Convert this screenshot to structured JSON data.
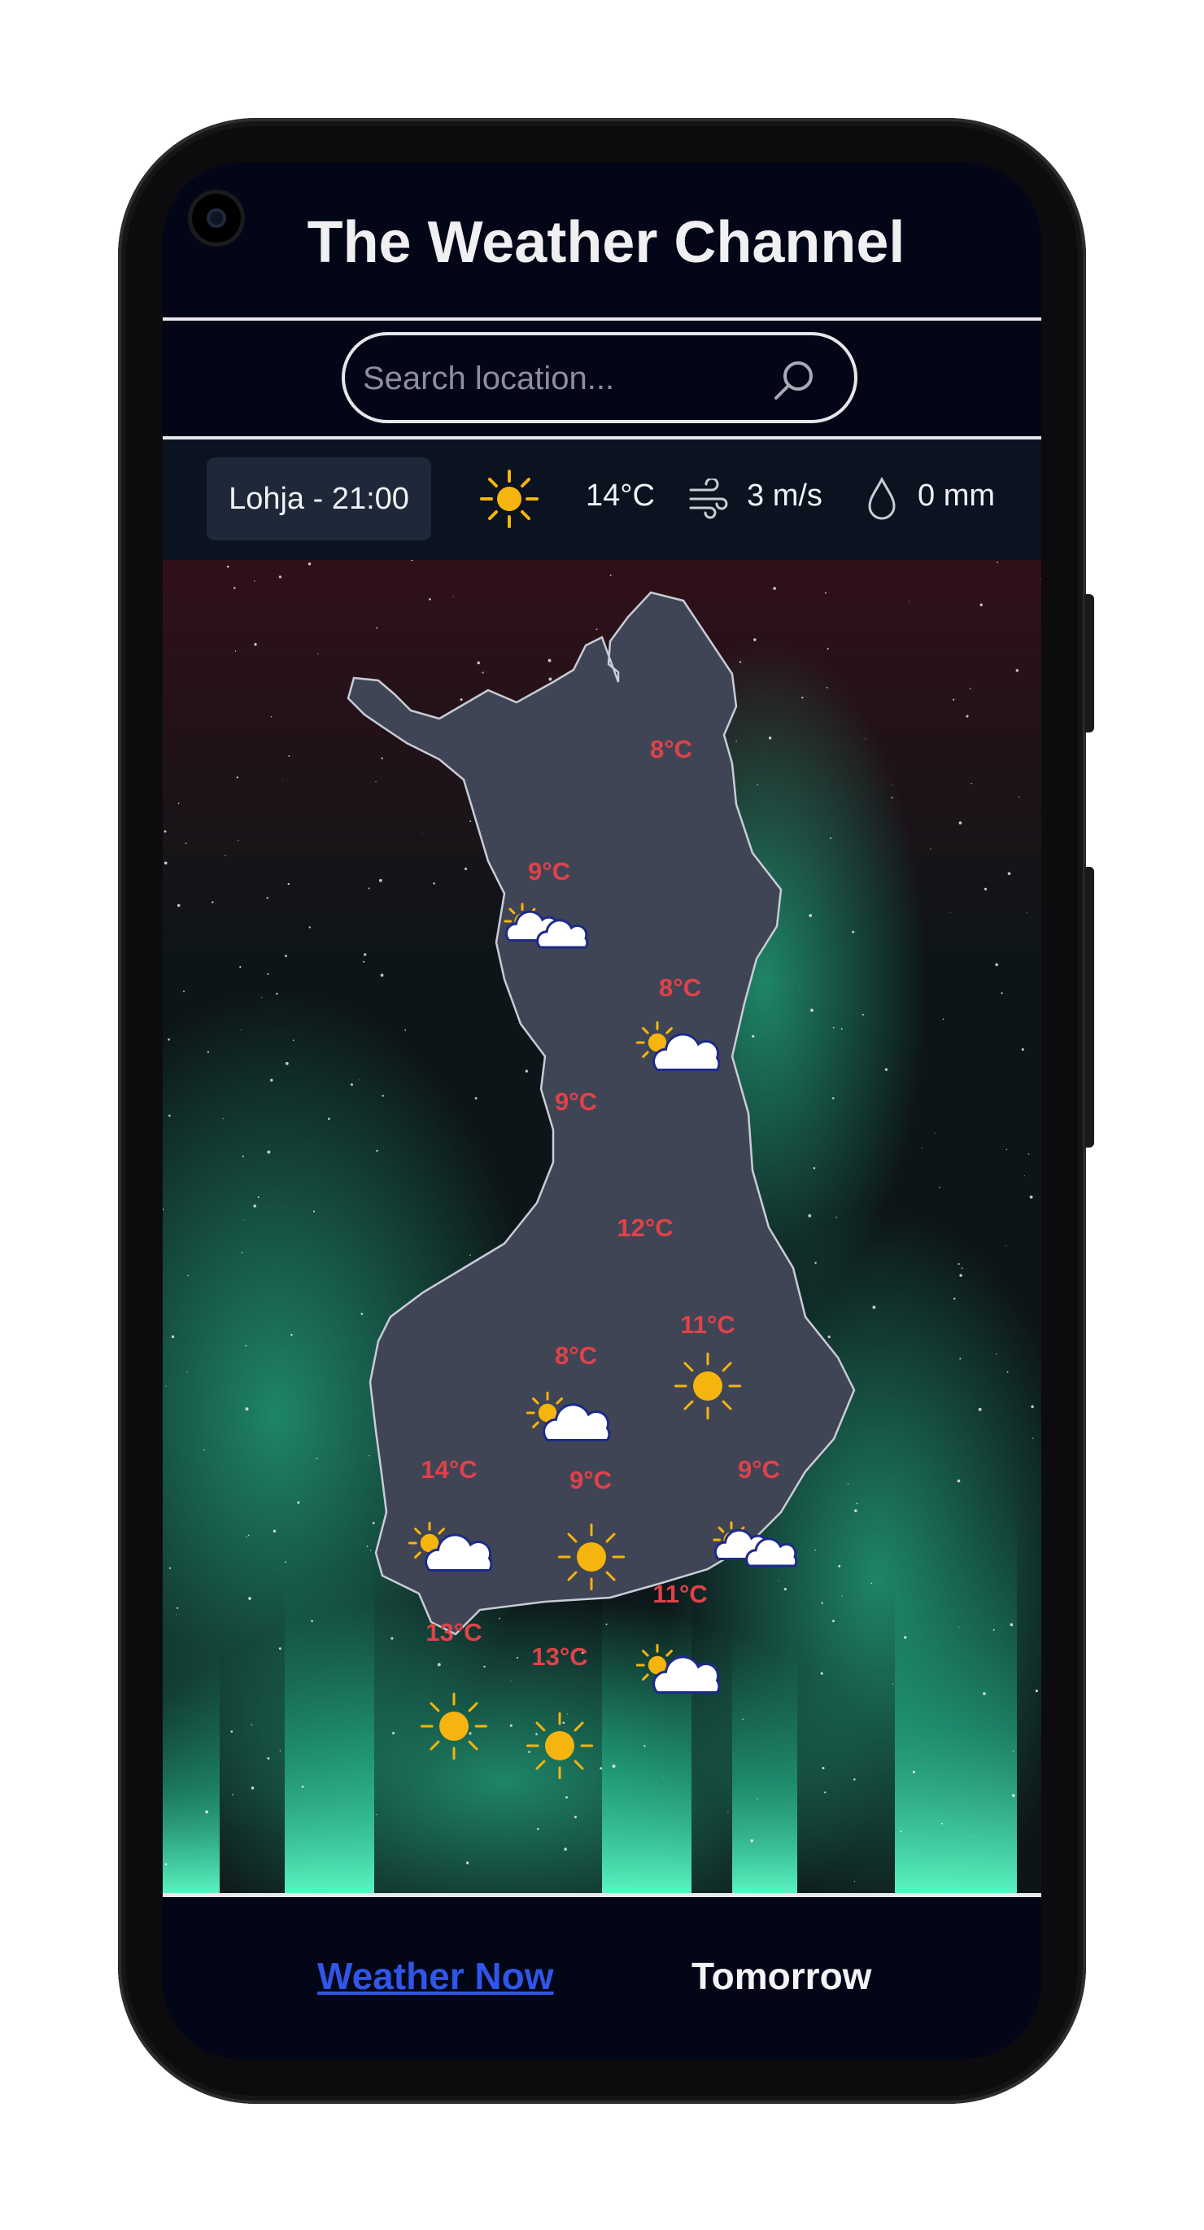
{
  "app": {
    "title": "The Weather Channel"
  },
  "search": {
    "placeholder": "Search location...",
    "value": ""
  },
  "current": {
    "location_time": "Lohja - 21:00",
    "condition_icon": "sun-icon",
    "temperature": "14°C",
    "wind": "3 m/s",
    "precipitation": "0 mm"
  },
  "map": {
    "cities": [
      {
        "temp": "8°C",
        "icon": ""
      },
      {
        "temp": "9°C",
        "icon": "partly-cloudy-icon"
      },
      {
        "temp": "8°C",
        "icon": "partly-cloudy-icon"
      },
      {
        "temp": "9°C",
        "icon": ""
      },
      {
        "temp": "12°C",
        "icon": ""
      },
      {
        "temp": "11°C",
        "icon": "sun-icon"
      },
      {
        "temp": "8°C",
        "icon": "partly-cloudy-icon"
      },
      {
        "temp": "14°C",
        "icon": "partly-cloudy-icon"
      },
      {
        "temp": "9°C",
        "icon": "sun-icon"
      },
      {
        "temp": "9°C",
        "icon": "partly-cloudy-icon"
      },
      {
        "temp": "11°C",
        "icon": "partly-cloudy-icon"
      },
      {
        "temp": "13°C",
        "icon": "sun-icon"
      },
      {
        "temp": "13°C",
        "icon": "sun-icon"
      }
    ]
  },
  "nav": {
    "now_label": "Weather Now",
    "tomorrow_label": "Tomorrow"
  },
  "colors": {
    "background": "#030617",
    "temperature_text": "#e0424a",
    "active_link": "#2f56e6",
    "sun": "#f6b40e",
    "cloud_outline": "#1d2a8a",
    "map_fill": "#3f4555"
  }
}
